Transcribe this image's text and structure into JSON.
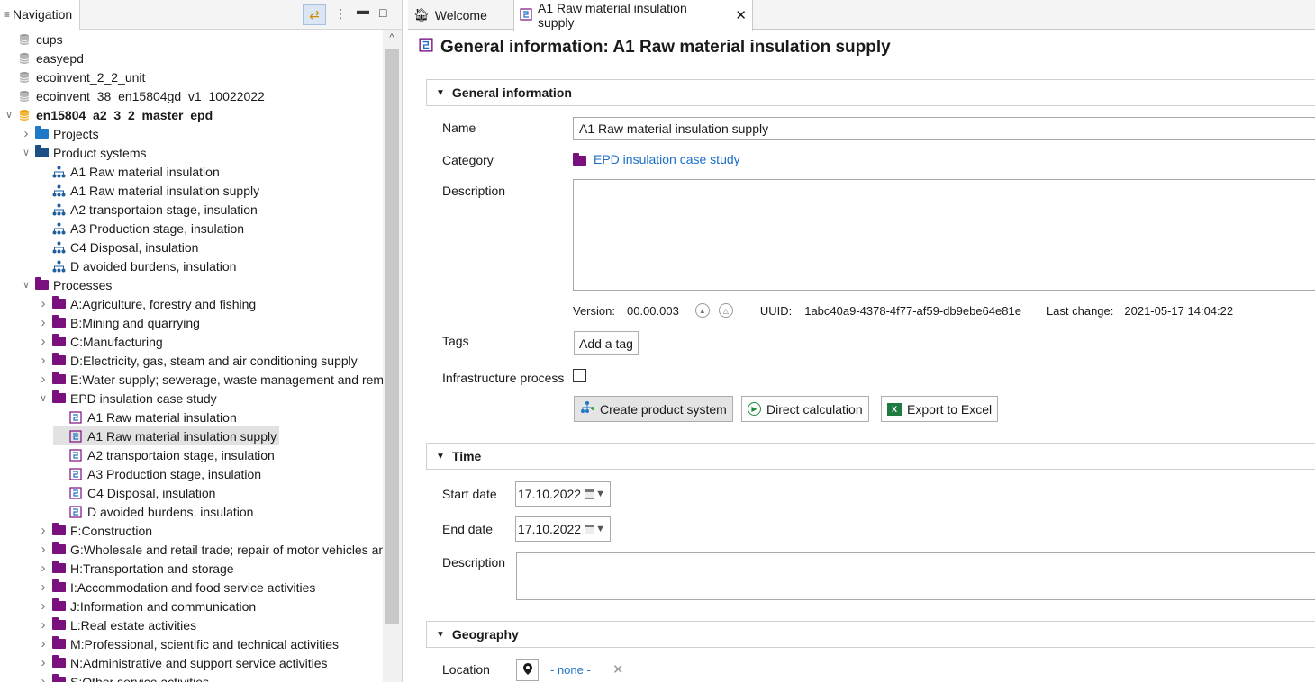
{
  "nav": {
    "title": "Navigation",
    "tree": [
      {
        "level": 0,
        "label": "cups",
        "icon": "database-icon",
        "twisty": ""
      },
      {
        "level": 0,
        "label": "easyepd",
        "icon": "database-icon",
        "twisty": ""
      },
      {
        "level": 0,
        "label": "ecoinvent_2_2_unit",
        "icon": "database-icon",
        "twisty": ""
      },
      {
        "level": 0,
        "label": "ecoinvent_38_en15804gd_v1_10022022",
        "icon": "database-icon",
        "twisty": ""
      },
      {
        "level": 0,
        "label": "en15804_a2_3_2_master_epd",
        "icon": "active-database-icon",
        "twisty": "expanded",
        "bold": true
      },
      {
        "level": 1,
        "label": "Projects",
        "icon": "folder-blue-icon",
        "twisty": "collapsed"
      },
      {
        "level": 1,
        "label": "Product systems",
        "icon": "folder-dark-icon",
        "twisty": "expanded"
      },
      {
        "level": 2,
        "label": "A1 Raw material insulation",
        "icon": "product-system-icon",
        "twisty": ""
      },
      {
        "level": 2,
        "label": "A1 Raw material insulation supply",
        "icon": "product-system-icon",
        "twisty": ""
      },
      {
        "level": 2,
        "label": "A2 transportaion stage, insulation",
        "icon": "product-system-icon",
        "twisty": ""
      },
      {
        "level": 2,
        "label": "A3 Production stage, insulation",
        "icon": "product-system-icon",
        "twisty": ""
      },
      {
        "level": 2,
        "label": "C4 Disposal, insulation",
        "icon": "product-system-icon",
        "twisty": ""
      },
      {
        "level": 2,
        "label": "D avoided burdens, insulation",
        "icon": "product-system-icon",
        "twisty": ""
      },
      {
        "level": 1,
        "label": "Processes",
        "icon": "folder-purple-icon",
        "twisty": "expanded"
      },
      {
        "level": 2,
        "label": "A:Agriculture, forestry and fishing",
        "icon": "folder-purple-icon",
        "twisty": "collapsed"
      },
      {
        "level": 2,
        "label": "B:Mining and quarrying",
        "icon": "folder-purple-icon",
        "twisty": "collapsed"
      },
      {
        "level": 2,
        "label": "C:Manufacturing",
        "icon": "folder-purple-icon",
        "twisty": "collapsed"
      },
      {
        "level": 2,
        "label": "D:Electricity, gas, steam and air conditioning supply",
        "icon": "folder-purple-icon",
        "twisty": "collapsed"
      },
      {
        "level": 2,
        "label": "E:Water supply; sewerage, waste management and reme",
        "icon": "folder-purple-icon",
        "twisty": "collapsed"
      },
      {
        "level": 2,
        "label": "EPD insulation case study",
        "icon": "folder-purple-icon",
        "twisty": "expanded"
      },
      {
        "level": 3,
        "label": "A1 Raw material insulation",
        "icon": "process-icon",
        "twisty": ""
      },
      {
        "level": 3,
        "label": "A1 Raw material insulation supply",
        "icon": "process-icon",
        "twisty": "",
        "selected": true
      },
      {
        "level": 3,
        "label": "A2 transportaion stage, insulation",
        "icon": "process-icon",
        "twisty": ""
      },
      {
        "level": 3,
        "label": "A3 Production stage, insulation",
        "icon": "process-icon",
        "twisty": ""
      },
      {
        "level": 3,
        "label": "C4 Disposal, insulation",
        "icon": "process-icon",
        "twisty": ""
      },
      {
        "level": 3,
        "label": "D avoided burdens, insulation",
        "icon": "process-icon",
        "twisty": ""
      },
      {
        "level": 2,
        "label": "F:Construction",
        "icon": "folder-purple-icon",
        "twisty": "collapsed"
      },
      {
        "level": 2,
        "label": "G:Wholesale and retail trade; repair of motor vehicles and",
        "icon": "folder-purple-icon",
        "twisty": "collapsed"
      },
      {
        "level": 2,
        "label": "H:Transportation and storage",
        "icon": "folder-purple-icon",
        "twisty": "collapsed"
      },
      {
        "level": 2,
        "label": "I:Accommodation and food service activities",
        "icon": "folder-purple-icon",
        "twisty": "collapsed"
      },
      {
        "level": 2,
        "label": "J:Information and communication",
        "icon": "folder-purple-icon",
        "twisty": "collapsed"
      },
      {
        "level": 2,
        "label": "L:Real estate activities",
        "icon": "folder-purple-icon",
        "twisty": "collapsed"
      },
      {
        "level": 2,
        "label": "M:Professional, scientific and technical activities",
        "icon": "folder-purple-icon",
        "twisty": "collapsed"
      },
      {
        "level": 2,
        "label": "N:Administrative and support service activities",
        "icon": "folder-purple-icon",
        "twisty": "collapsed"
      },
      {
        "level": 2,
        "label": "S:Other service activities",
        "icon": "folder-purple-icon",
        "twisty": "collapsed"
      }
    ]
  },
  "tabs": {
    "welcome": "Welcome",
    "active": "A1 Raw material insulation supply"
  },
  "page": {
    "title": "General information: A1 Raw material insulation supply"
  },
  "general": {
    "header": "General information",
    "name_label": "Name",
    "name_value": "A1 Raw material insulation supply",
    "category_label": "Category",
    "category_value": "EPD insulation case study",
    "description_label": "Description",
    "description_value": "",
    "version_label": "Version:",
    "version_value": "00.00.003",
    "uuid_label": "UUID:",
    "uuid_value": "1abc40a9-4378-4f77-af59-db9ebe64e81e",
    "last_change_label": "Last change:",
    "last_change_value": "2021-05-17 14:04:22",
    "tags_label": "Tags",
    "add_tag": "Add a tag",
    "infra_label": "Infrastructure process",
    "infra_checked": false,
    "create_ps": "Create product system",
    "direct_calc": "Direct calculation",
    "export_excel": "Export to Excel"
  },
  "time": {
    "header": "Time",
    "start_label": "Start date",
    "start_value": "17.10.2022",
    "end_label": "End date",
    "end_value": "17.10.2022",
    "description_label": "Description",
    "description_value": ""
  },
  "geography": {
    "header": "Geography",
    "location_label": "Location",
    "location_value": "- none -"
  },
  "colors": {
    "accent": "#1c6fc6",
    "process_purple": "#7a0f7e",
    "folder_blue": "#1f78c8",
    "database_orange": "#e8a21a"
  }
}
